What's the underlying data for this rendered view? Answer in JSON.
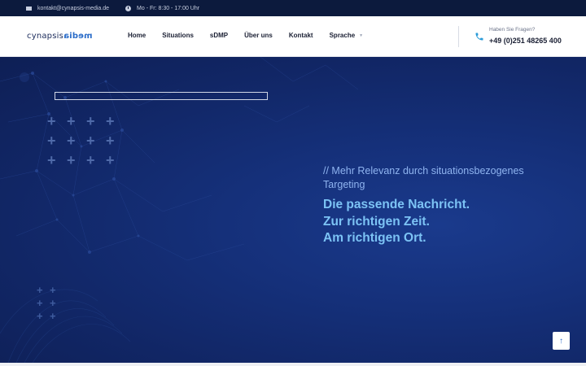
{
  "topbar": {
    "email": "kontakt@cynapsis-media.de",
    "hours": "Mo - Fr: 8:30 - 17:00 Uhr",
    "email_icon": "envelope-icon",
    "hours_icon": "clock-icon"
  },
  "header": {
    "logo_text_a": "cynapsis",
    "logo_text_b": "media",
    "nav": [
      {
        "label": "Home"
      },
      {
        "label": "Situations"
      },
      {
        "label": "sDMP"
      },
      {
        "label": "Über uns"
      },
      {
        "label": "Kontakt"
      },
      {
        "label": "Sprache"
      }
    ],
    "contact_question": "Haben Sie Fragen?",
    "contact_phone": "+49 (0)251 48265 400",
    "phone_icon": "phone-icon"
  },
  "hero": {
    "tagline": "// Mehr Relevanz durch situationsbezogenes Targeting",
    "headline_line1": "Die passende Nachricht.",
    "headline_line2": "Zur richtigen Zeit.",
    "headline_line3": "Am richtigen Ort."
  },
  "back_to_top_icon": "arrow-up-icon",
  "colors": {
    "topbar_bg": "#0c1a3d",
    "hero_bg": "#15307a",
    "accent": "#2a6cc9",
    "headline": "#7cc3f5"
  }
}
